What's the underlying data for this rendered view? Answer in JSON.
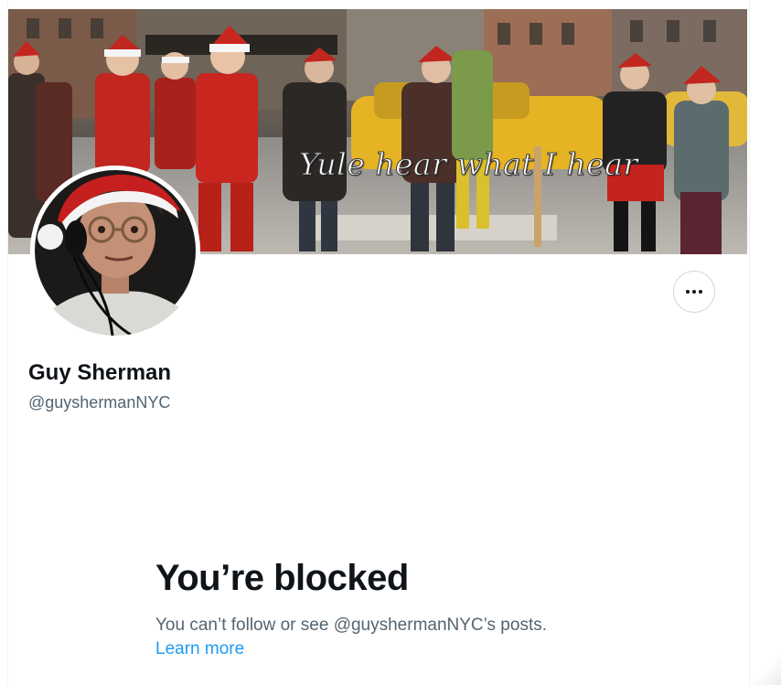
{
  "profile": {
    "banner_caption": "Yule hear what I hear",
    "display_name": "Guy Sherman",
    "handle": "@guyshermanNYC",
    "more_icon": "more-horizontal-icon"
  },
  "blocked": {
    "title": "You’re blocked",
    "message": "You can’t follow or see @guyshermanNYC’s posts.",
    "learn_more": "Learn more"
  },
  "colors": {
    "text_primary": "#0f1419",
    "text_secondary": "#536471",
    "link": "#1d9bf0",
    "border": "#cfd9de"
  }
}
